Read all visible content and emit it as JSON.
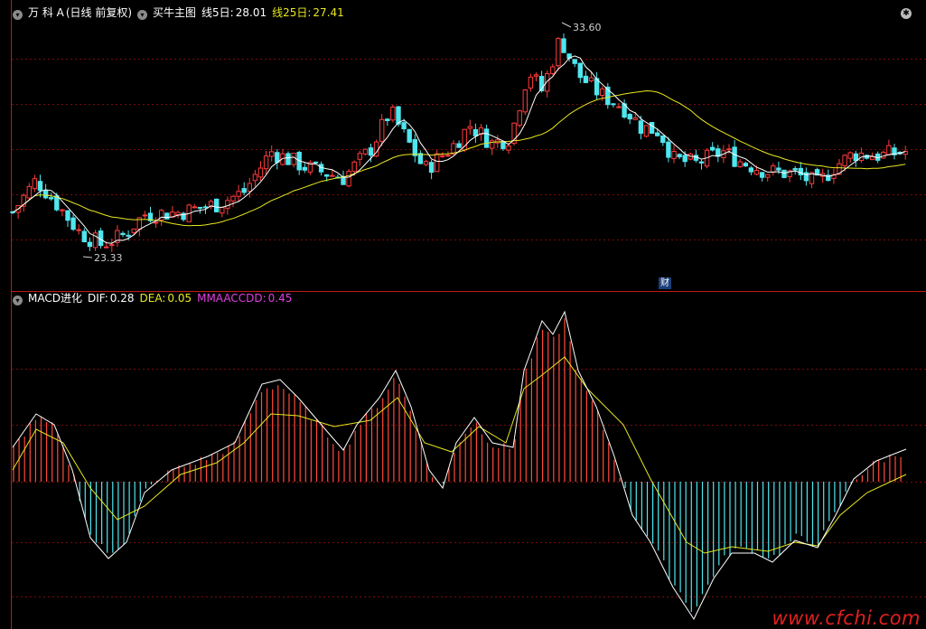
{
  "header_top": {
    "stock": "万 科 A",
    "period": "(日线 前复权)",
    "indicator": "买牛主图",
    "ma5_label": "线5日:",
    "ma5_value": "28.01",
    "ma25_label": "线25日:",
    "ma25_value": "27.41"
  },
  "header_macd": {
    "name": "MACD进化",
    "dif_label": "DIF:",
    "dif_value": "0.28",
    "dea_label": "DEA:",
    "dea_value": "0.05",
    "mm_label": "MMAACCDD:",
    "mm_value": "0.45"
  },
  "badge": "财",
  "watermark": "www.cfchi.com",
  "colors": {
    "up": "#ff3b3b",
    "down": "#4fe6ee",
    "ma5": "#ffffff",
    "ma25": "#e8e820",
    "grid": "#7a0a0a",
    "border": "#c01818",
    "dif_label": "#ffffff",
    "dea_label": "#e8e820",
    "mm_label": "#e040e0",
    "hist_pos": "#ff4a3a",
    "hist_neg": "#4fe6ee"
  },
  "chart_data": [
    {
      "type": "candlestick",
      "title": "买牛主图",
      "series": [
        {
          "name": "线5日",
          "last": 28.01
        },
        {
          "name": "线25日",
          "last": 27.41
        }
      ],
      "annotations": [
        {
          "label": "33.60",
          "kind": "high",
          "value": 33.6
        },
        {
          "label": "23.33",
          "kind": "low",
          "value": 23.33
        }
      ],
      "ylim": [
        22.0,
        34.5
      ],
      "grid": true
    },
    {
      "type": "line",
      "title": "MACD进化",
      "series": [
        {
          "name": "DIF",
          "last": 0.28
        },
        {
          "name": "DEA",
          "last": 0.05
        },
        {
          "name": "MMAACCDD",
          "last": 0.45
        }
      ],
      "grid": true
    }
  ]
}
